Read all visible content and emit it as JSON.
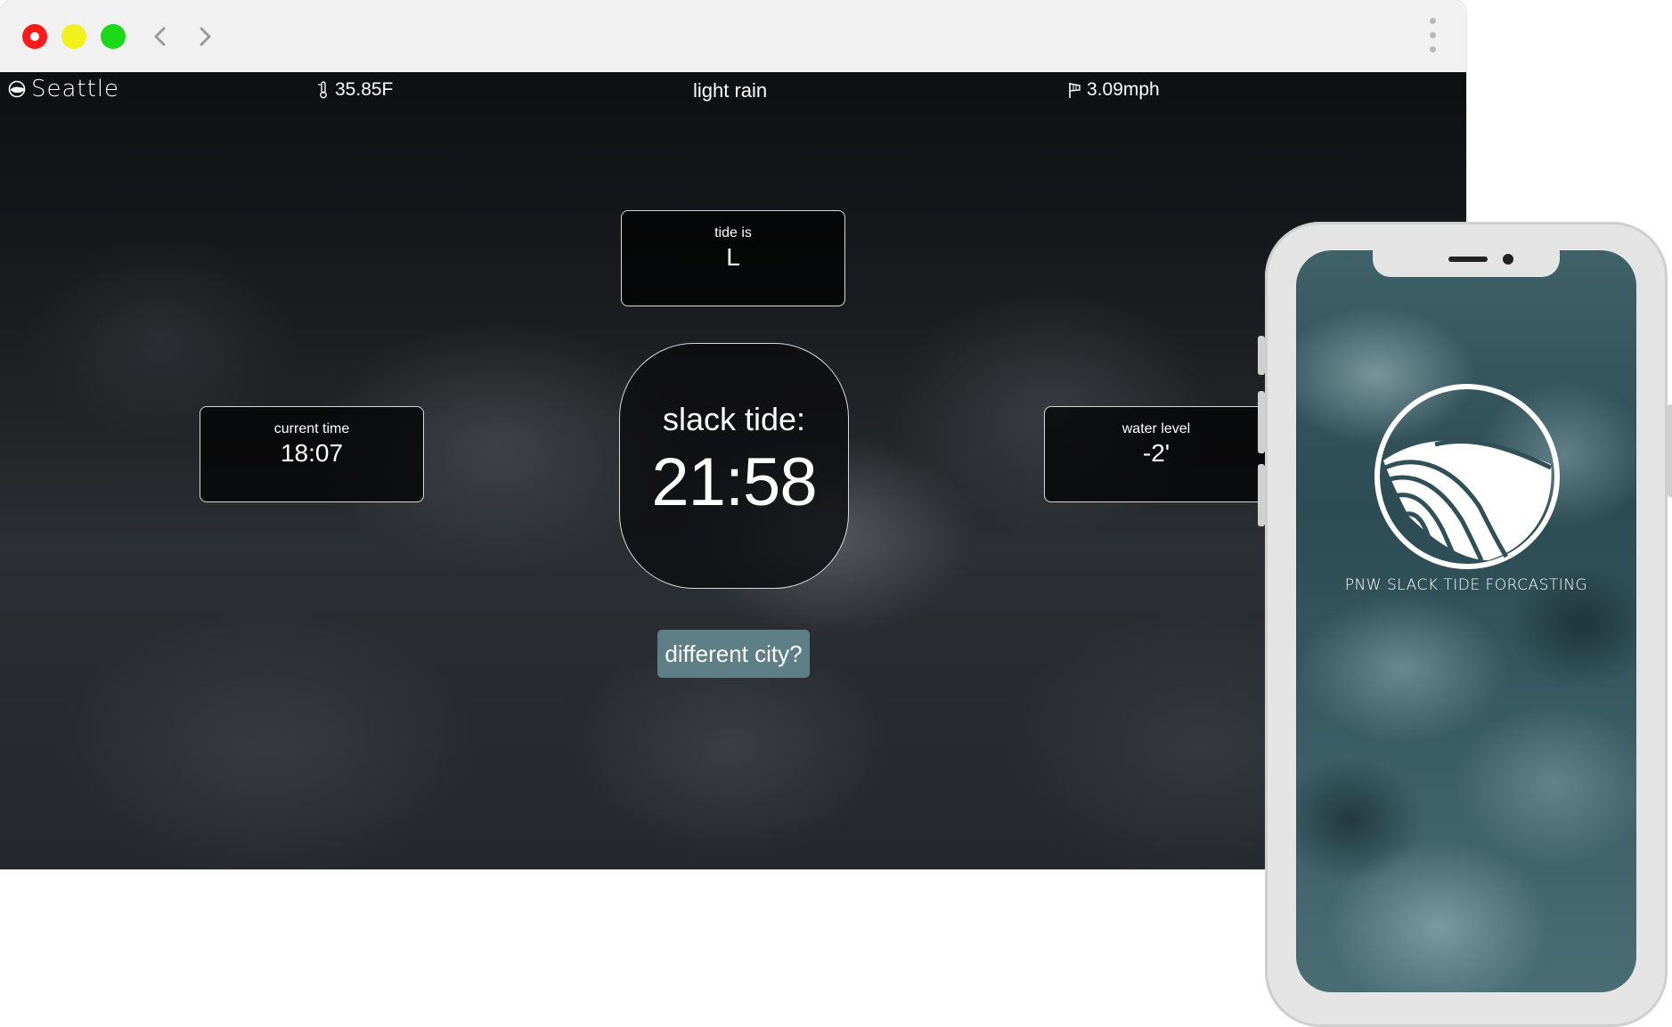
{
  "browser": {
    "window_controls": [
      "close",
      "minimize",
      "maximize"
    ],
    "nav": {
      "back_icon": "chevron-left-icon",
      "forward_icon": "chevron-right-icon"
    },
    "menu_icon": "kebab-menu-icon"
  },
  "weather_bar": {
    "city": "Seattle",
    "temperature": "35.85F",
    "condition": "light rain",
    "wind": "3.09mph"
  },
  "cards": {
    "tide": {
      "label": "tide is",
      "value": "L"
    },
    "current_time": {
      "label": "current time",
      "value": "18:07"
    },
    "water_level": {
      "label": "water level",
      "value": "-2'"
    },
    "slack": {
      "label": "slack tide:",
      "value": "21:58"
    }
  },
  "actions": {
    "different_city": "different city?"
  },
  "phone": {
    "brand_text": "PNW SLACK TIDE FORCASTING"
  },
  "colors": {
    "button": "#5e7f86",
    "close": "#ff1a1a",
    "minimize": "#f2f21a",
    "maximize": "#19d919"
  }
}
